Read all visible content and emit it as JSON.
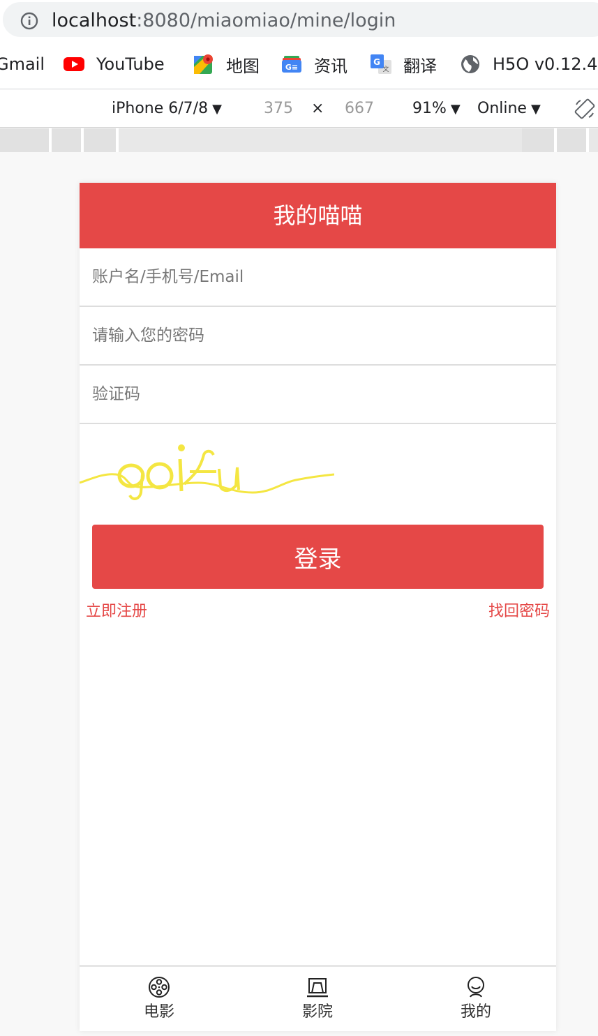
{
  "browser": {
    "url_host": "localhost",
    "url_rest": ":8080/miaomiao/mine/login",
    "bookmarks": [
      {
        "label": "Gmail",
        "icon": "gmail-icon"
      },
      {
        "label": "YouTube",
        "icon": "youtube-icon"
      },
      {
        "label": "地图",
        "icon": "maps-icon"
      },
      {
        "label": "资讯",
        "icon": "news-icon"
      },
      {
        "label": "翻译",
        "icon": "translate-icon"
      },
      {
        "label": "H5O v0.12.4",
        "icon": "globe-icon"
      }
    ]
  },
  "devtools": {
    "device": "iPhone 6/7/8",
    "width": "375",
    "times": "×",
    "height": "667",
    "zoom": "91%",
    "network": "Online",
    "caret": "▼"
  },
  "app": {
    "header_title": "我的喵喵",
    "username_placeholder": "账户名/手机号/Email",
    "password_placeholder": "请输入您的密码",
    "captcha_placeholder": "验证码",
    "login_label": "登录",
    "register_link": "立即注册",
    "forgot_link": "找回密码",
    "tabs": [
      {
        "label": "电影",
        "icon": "film-reel-icon"
      },
      {
        "label": "影院",
        "icon": "cinema-icon"
      },
      {
        "label": "我的",
        "icon": "user-icon"
      }
    ],
    "colors": {
      "accent": "#e54847",
      "captcha": "#f4e642"
    }
  }
}
